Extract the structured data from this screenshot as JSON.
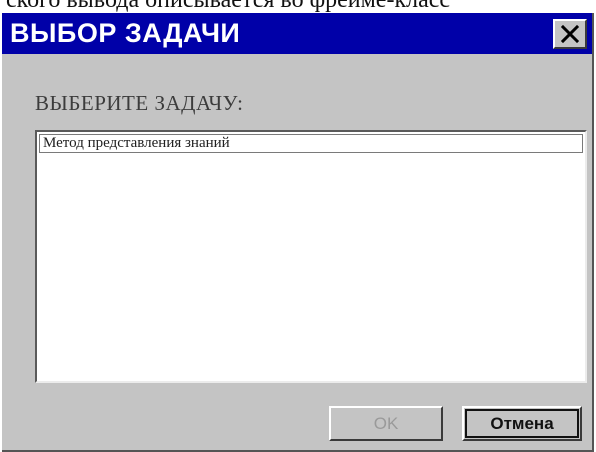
{
  "background_text": "ского вывода описывается во фрейме-класс",
  "dialog": {
    "title": "ВЫБОР ЗАДАЧИ",
    "close_icon": "close-icon",
    "prompt": "ВЫБЕРИТЕ ЗАДАЧУ:",
    "list": {
      "items": [
        "Метод представления знаний"
      ]
    },
    "buttons": {
      "ok_label": "OK",
      "ok_state": "disabled",
      "cancel_label": "Отмена"
    }
  },
  "colors": {
    "titlebar": "#0000a8",
    "face": "#c4c4c4",
    "disabled_text": "#9a9a9a"
  }
}
